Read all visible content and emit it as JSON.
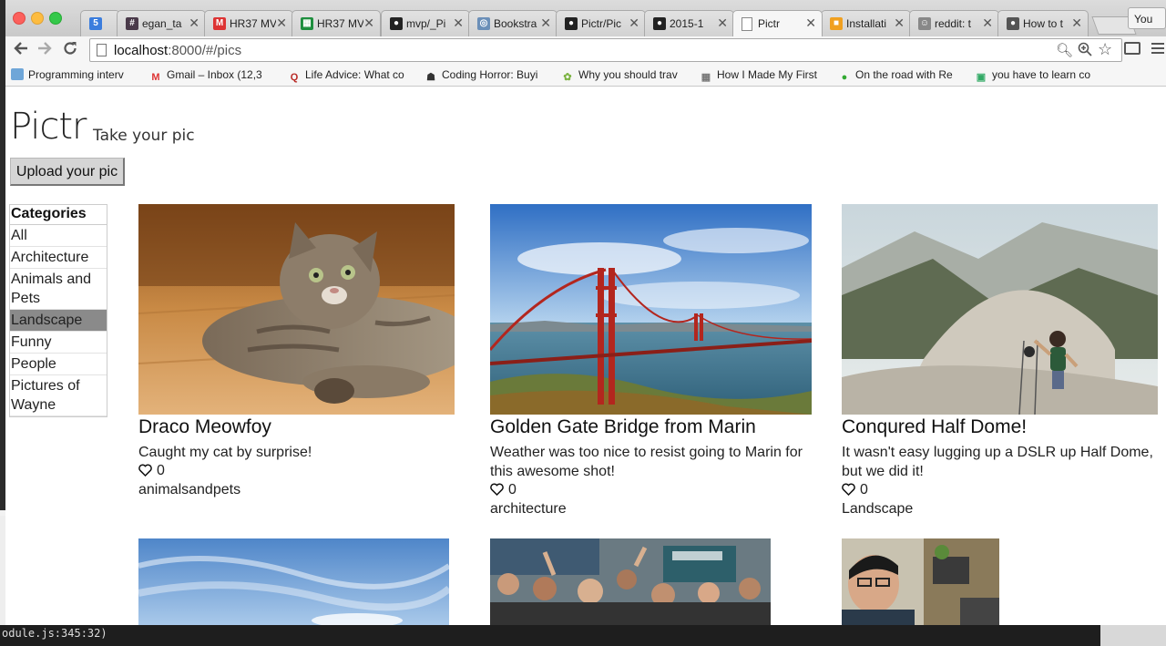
{
  "browser": {
    "tabs": [
      {
        "icon": "calendar-icon",
        "icon_text": "5",
        "icon_color": "#3b7ddd",
        "title": ""
      },
      {
        "icon": "slack-icon",
        "icon_text": "#",
        "icon_color": "#4a3a4a",
        "title": "egan_ta"
      },
      {
        "icon": "gmail-icon",
        "icon_text": "M",
        "icon_color": "#d33",
        "title": "HR37 MV"
      },
      {
        "icon": "sheets-icon",
        "icon_text": "▦",
        "icon_color": "#1e8e3e",
        "title": "HR37 MV"
      },
      {
        "icon": "github-icon",
        "icon_text": "●",
        "icon_color": "#222",
        "title": "mvp/_Pi"
      },
      {
        "icon": "globe-icon",
        "icon_text": "◎",
        "icon_color": "#6b8fb8",
        "title": "Bookstra"
      },
      {
        "icon": "github-icon",
        "icon_text": "●",
        "icon_color": "#222",
        "title": "Pictr/Pic"
      },
      {
        "icon": "github-icon",
        "icon_text": "●",
        "icon_color": "#222",
        "title": "2015-1"
      },
      {
        "icon": "page-icon",
        "icon_text": "",
        "icon_color": "#fff",
        "title": "Pictr"
      },
      {
        "icon": "box-icon",
        "icon_text": "■",
        "icon_color": "#f0a020",
        "title": "Installati"
      },
      {
        "icon": "reddit-icon",
        "icon_text": "☺",
        "icon_color": "#888",
        "title": "reddit: t"
      },
      {
        "icon": "apple-icon",
        "icon_text": "●",
        "icon_color": "#555",
        "title": "How to t"
      }
    ],
    "profile": "You",
    "url_host": "localhost",
    "url_path": ":8000/#/pics",
    "bookmarks": [
      {
        "icon": "folder-icon",
        "icon_text": "",
        "icon_color": "#6fa6d8",
        "label": "Programming interv"
      },
      {
        "icon": "gmail-icon",
        "icon_text": "M",
        "icon_color": "#d33",
        "label": "Gmail – Inbox (12,3"
      },
      {
        "icon": "quora-icon",
        "icon_text": "Q",
        "icon_color": "#b92b27",
        "label": "Life Advice: What co"
      },
      {
        "icon": "coding-horror-icon",
        "icon_text": "☗",
        "icon_color": "#333",
        "label": "Coding Horror: Buyi"
      },
      {
        "icon": "leaf-icon",
        "icon_text": "✿",
        "icon_color": "#7cb342",
        "label": "Why you should trav"
      },
      {
        "icon": "grid-icon",
        "icon_text": "▦",
        "icon_color": "#777",
        "label": "How I Made My First"
      },
      {
        "icon": "circle-icon",
        "icon_text": "●",
        "icon_color": "#3a3",
        "label": "On the road with Re"
      },
      {
        "icon": "robot-icon",
        "icon_text": "▣",
        "icon_color": "#3a6",
        "label": "you have to learn co"
      }
    ]
  },
  "app": {
    "title": "Pictr",
    "tagline": "Take your pic",
    "upload_label": "Upload your pic",
    "categories_header": "Categories",
    "categories": [
      "All",
      "Architecture",
      "Animals and Pets",
      "Landscape",
      "Funny",
      "People",
      "Pictures of Wayne"
    ],
    "selected_category": "Landscape"
  },
  "pics": [
    {
      "title": "Draco Meowfoy",
      "description": "Caught my cat by surprise!",
      "likes": "0",
      "category": "animalsandpets"
    },
    {
      "title": "Golden Gate Bridge from Marin",
      "description": "Weather was too nice to resist going to Marin for this awesome shot!",
      "likes": "0",
      "category": "architecture"
    },
    {
      "title": "Conqured Half Dome!",
      "description": "It wasn't easy lugging up a DSLR up Half Dome, but we did it!",
      "likes": "0",
      "category": "Landscape"
    }
  ],
  "terminal": {
    "line": "odule.js:345:32)"
  }
}
